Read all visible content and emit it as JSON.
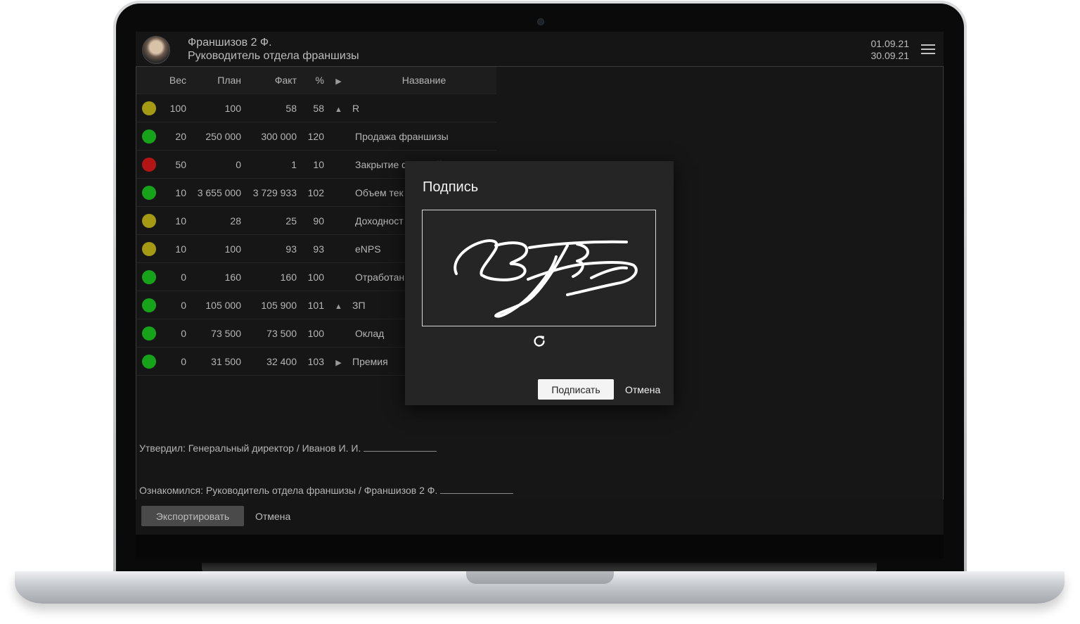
{
  "header": {
    "user_name": "Франшизов 2 Ф.",
    "user_role": "Руководитель отдела франшизы",
    "date_from": "01.09.21",
    "date_to": "30.09.21"
  },
  "table": {
    "columns": {
      "weight": "Вес",
      "plan": "План",
      "fact": "Факт",
      "percent": "%",
      "name": "Название"
    },
    "rows": [
      {
        "status": "yellow",
        "weight": "100",
        "plan": "100",
        "fact": "58",
        "percent": "58",
        "arrow": "up",
        "name": "R"
      },
      {
        "status": "green",
        "weight": "20",
        "plan": "250 000",
        "fact": "300 000",
        "percent": "120",
        "arrow": "",
        "name": "Продажа франшизы"
      },
      {
        "status": "red",
        "weight": "50",
        "plan": "0",
        "fact": "1",
        "percent": "10",
        "arrow": "",
        "name": "Закрытие франчайзи"
      },
      {
        "status": "green",
        "weight": "10",
        "plan": "3 655 000",
        "fact": "3 729 933",
        "percent": "102",
        "arrow": "",
        "name": "Объем тек"
      },
      {
        "status": "yellow",
        "weight": "10",
        "plan": "28",
        "fact": "25",
        "percent": "90",
        "arrow": "",
        "name": "Доходност"
      },
      {
        "status": "yellow",
        "weight": "10",
        "plan": "100",
        "fact": "93",
        "percent": "93",
        "arrow": "",
        "name": "eNPS"
      },
      {
        "status": "green",
        "weight": "0",
        "plan": "160",
        "fact": "160",
        "percent": "100",
        "arrow": "",
        "name": "Отработан"
      },
      {
        "status": "green",
        "weight": "0",
        "plan": "105 000",
        "fact": "105 900",
        "percent": "101",
        "arrow": "up",
        "name": "ЗП"
      },
      {
        "status": "green",
        "weight": "0",
        "plan": "73 500",
        "fact": "73 500",
        "percent": "100",
        "arrow": "",
        "name": "Оклад"
      },
      {
        "status": "green",
        "weight": "0",
        "plan": "31 500",
        "fact": "32 400",
        "percent": "103",
        "arrow": "right",
        "name": "Премия"
      }
    ]
  },
  "colors": {
    "yellow": "#a59a14",
    "green": "#16a31a",
    "red": "#b31414"
  },
  "approval": {
    "approved": "Утвердил: Генеральный директор / Иванов И. И.",
    "acknowledged": "Ознакомился: Руководитель отдела франшизы / Франшизов 2 Ф."
  },
  "footer": {
    "export_label": "Экспортировать",
    "cancel_label": "Отмена"
  },
  "dialog": {
    "title": "Подпись",
    "sign_label": "Подписать",
    "cancel_label": "Отмена"
  }
}
